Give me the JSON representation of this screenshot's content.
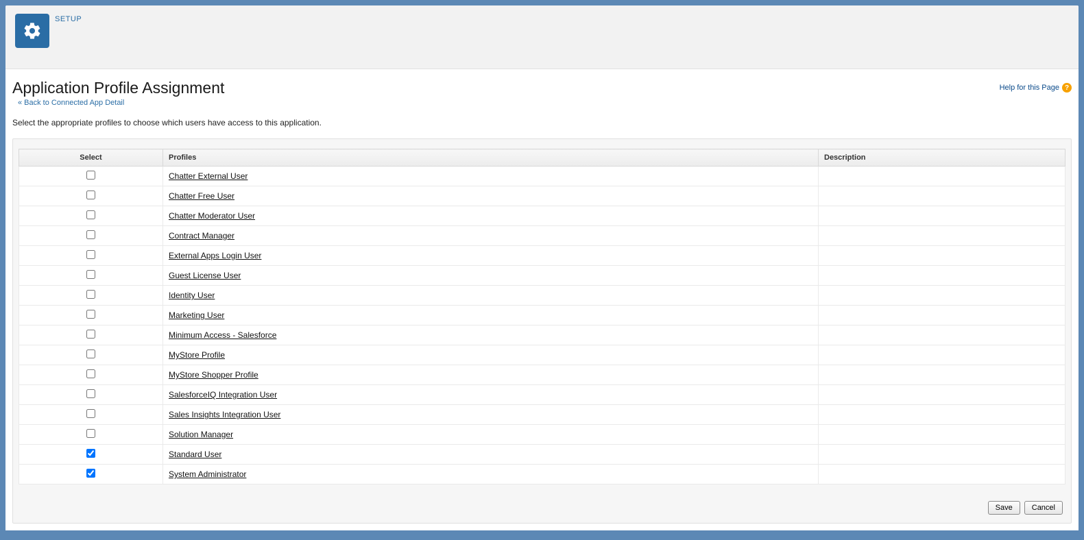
{
  "header": {
    "setup_label": "SETUP"
  },
  "page": {
    "title": "Application Profile Assignment",
    "back_link": "« Back to Connected App Detail",
    "help_label": "Help for this Page",
    "instruction": "Select the appropriate profiles to choose which users have access to this application."
  },
  "table": {
    "columns": {
      "select": "Select",
      "profiles": "Profiles",
      "description": "Description"
    },
    "rows": [
      {
        "label": "Chatter External User",
        "checked": false,
        "description": ""
      },
      {
        "label": "Chatter Free User",
        "checked": false,
        "description": ""
      },
      {
        "label": "Chatter Moderator User",
        "checked": false,
        "description": ""
      },
      {
        "label": "Contract Manager",
        "checked": false,
        "description": ""
      },
      {
        "label": "External Apps Login User",
        "checked": false,
        "description": ""
      },
      {
        "label": "Guest License User",
        "checked": false,
        "description": ""
      },
      {
        "label": "Identity User",
        "checked": false,
        "description": ""
      },
      {
        "label": "Marketing User",
        "checked": false,
        "description": ""
      },
      {
        "label": "Minimum Access - Salesforce",
        "checked": false,
        "description": ""
      },
      {
        "label": "MyStore Profile",
        "checked": false,
        "description": ""
      },
      {
        "label": "MyStore Shopper Profile",
        "checked": false,
        "description": ""
      },
      {
        "label": "SalesforceIQ Integration User",
        "checked": false,
        "description": ""
      },
      {
        "label": "Sales Insights Integration User",
        "checked": false,
        "description": ""
      },
      {
        "label": "Solution Manager",
        "checked": false,
        "description": ""
      },
      {
        "label": "Standard User",
        "checked": true,
        "description": ""
      },
      {
        "label": "System Administrator",
        "checked": true,
        "description": ""
      }
    ]
  },
  "buttons": {
    "save": "Save",
    "cancel": "Cancel"
  }
}
